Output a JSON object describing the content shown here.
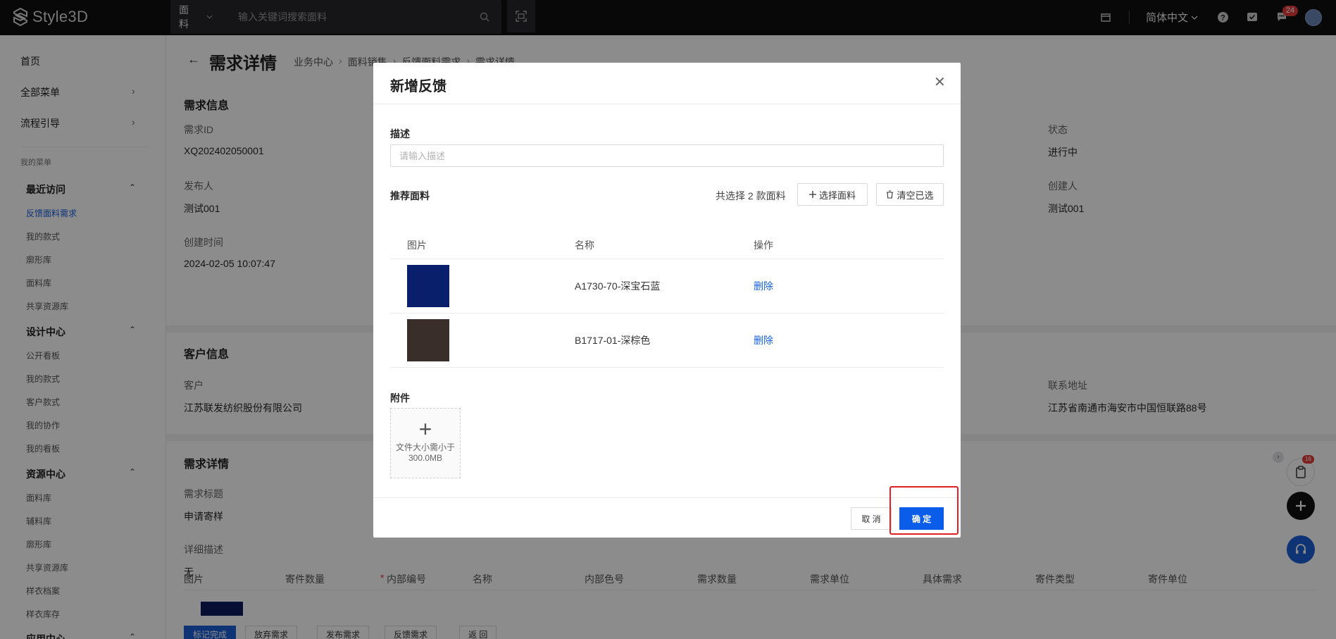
{
  "topbar": {
    "logo_text": "Style3D",
    "search_category": "面料",
    "search_placeholder": "输入关键词搜索面料",
    "language": "简体中文",
    "notification_count": "24"
  },
  "sidebar": {
    "home": "首页",
    "all_menu": "全部菜单",
    "guide": "流程引导",
    "my_menu_label": "我的菜单",
    "groups": [
      {
        "title": "最近访问",
        "items": [
          "反馈面料需求",
          "我的款式",
          "廓形库",
          "面料库",
          "共享资源库"
        ]
      },
      {
        "title": "设计中心",
        "items": [
          "公开看板",
          "我的款式",
          "客户款式",
          "我的协作",
          "我的看板"
        ]
      },
      {
        "title": "资源中心",
        "items": [
          "面料库",
          "辅料库",
          "廓形库",
          "共享资源库",
          "样衣档案",
          "样衣库存"
        ]
      },
      {
        "title": "应用中心",
        "items": []
      }
    ]
  },
  "page": {
    "title": "需求详情",
    "breadcrumb": [
      "业务中心",
      "面料销售",
      "反馈面料需求",
      "需求详情"
    ],
    "section_info": {
      "title": "需求信息",
      "fields": [
        {
          "label": "需求ID",
          "value": "XQ202402050001"
        },
        {
          "label": "发布人",
          "value": "测试001"
        },
        {
          "label": "创建时间",
          "value": "2024-02-05 10:07:47"
        },
        {
          "label": "状态",
          "value": "进行中"
        },
        {
          "label": "创建人",
          "value": "测试001"
        }
      ]
    },
    "section_customer": {
      "title": "客户信息",
      "fields": [
        {
          "label": "客户",
          "value": "江苏联发纺织股份有限公司"
        },
        {
          "label": "联系地址",
          "value": "江苏省南通市海安市中国恒联路88号"
        }
      ]
    },
    "section_detail": {
      "title": "需求详情",
      "fields": [
        {
          "label": "需求标题",
          "value": "申请寄样"
        },
        {
          "label": "详细描述",
          "value": "无"
        }
      ],
      "columns": [
        "图片",
        "寄件数量",
        "内部编号",
        "名称",
        "内部色号",
        "需求数量",
        "需求单位",
        "具体需求",
        "寄件类型",
        "寄件单位"
      ],
      "required_mark": "*"
    },
    "bottom_actions": [
      "标记完成",
      "放弃需求",
      "发布需求",
      "反馈需求",
      "返 回"
    ]
  },
  "floating": {
    "cart_badge": "16"
  },
  "modal": {
    "title": "新增反馈",
    "desc_label": "描述",
    "desc_placeholder": "请输入描述",
    "fabric_label": "推荐面料",
    "selected_text": "共选择 2 款面料",
    "select_btn": "选择面料",
    "clear_btn": "清空已选",
    "columns": [
      "图片",
      "名称",
      "操作"
    ],
    "rows": [
      {
        "name": "A1730-70-深宝石蓝",
        "action": "删除",
        "color": "#0a1f6b"
      },
      {
        "name": "B1717-01-深棕色",
        "action": "删除",
        "color": "#3a2e2a"
      }
    ],
    "attachment_label": "附件",
    "upload_hint": "文件大小需小于300.0MB",
    "cancel": "取 消",
    "confirm": "确 定"
  }
}
